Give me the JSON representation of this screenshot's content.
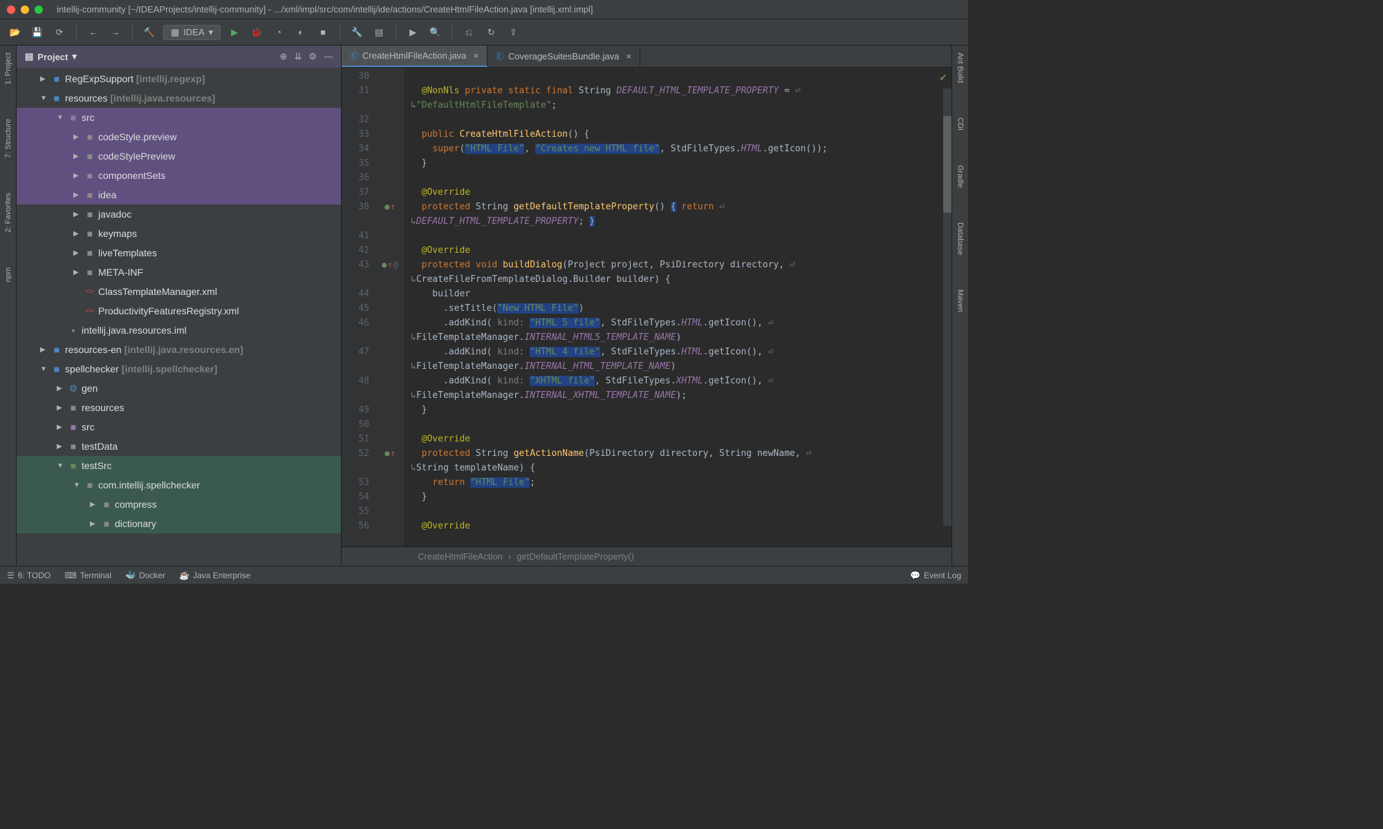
{
  "titlebar": "intellij-community [~/IDEAProjects/intellij-community] - .../xml/impl/src/com/intellij/ide/actions/CreateHtmlFileAction.java [intellij.xml.impl]",
  "runConfig": "IDEA",
  "projectPanel": {
    "title": "Project"
  },
  "tree": [
    {
      "indent": 1,
      "arrow": "▶",
      "iconClass": "folder-blue",
      "icon": "■",
      "label": "RegExpSupport",
      "meta": "[intellij.regexp]",
      "sel": ""
    },
    {
      "indent": 1,
      "arrow": "▼",
      "iconClass": "folder-blue",
      "icon": "■",
      "label": "resources",
      "meta": "[intellij.java.resources]",
      "sel": ""
    },
    {
      "indent": 2,
      "arrow": "▼",
      "iconClass": "folder-purple",
      "icon": "■",
      "label": "src",
      "meta": "",
      "sel": "sel-purple"
    },
    {
      "indent": 3,
      "arrow": "▶",
      "iconClass": "folder-icon",
      "icon": "■",
      "label": "codeStyle.preview",
      "meta": "",
      "sel": "sel-purple"
    },
    {
      "indent": 3,
      "arrow": "▶",
      "iconClass": "folder-icon",
      "icon": "■",
      "label": "codeStylePreview",
      "meta": "",
      "sel": "sel-purple"
    },
    {
      "indent": 3,
      "arrow": "▶",
      "iconClass": "folder-icon",
      "icon": "■",
      "label": "componentSets",
      "meta": "",
      "sel": "sel-purple"
    },
    {
      "indent": 3,
      "arrow": "▶",
      "iconClass": "folder-icon",
      "icon": "■",
      "label": "idea",
      "meta": "",
      "sel": "sel-purple"
    },
    {
      "indent": 3,
      "arrow": "▶",
      "iconClass": "folder-icon",
      "icon": "■",
      "label": "javadoc",
      "meta": "",
      "sel": ""
    },
    {
      "indent": 3,
      "arrow": "▶",
      "iconClass": "folder-icon",
      "icon": "■",
      "label": "keymaps",
      "meta": "",
      "sel": ""
    },
    {
      "indent": 3,
      "arrow": "▶",
      "iconClass": "folder-icon",
      "icon": "■",
      "label": "liveTemplates",
      "meta": "",
      "sel": ""
    },
    {
      "indent": 3,
      "arrow": "▶",
      "iconClass": "folder-icon",
      "icon": "■",
      "label": "META-INF",
      "meta": "",
      "sel": ""
    },
    {
      "indent": 3,
      "arrow": "",
      "iconClass": "xml-icon",
      "icon": "<>",
      "label": "ClassTemplateManager.xml",
      "meta": "",
      "sel": ""
    },
    {
      "indent": 3,
      "arrow": "",
      "iconClass": "xml-icon",
      "icon": "<>",
      "label": "ProductivityFeaturesRegistry.xml",
      "meta": "",
      "sel": ""
    },
    {
      "indent": 2,
      "arrow": "",
      "iconClass": "folder-icon",
      "icon": "▪",
      "label": "intellij.java.resources.iml",
      "meta": "",
      "sel": ""
    },
    {
      "indent": 1,
      "arrow": "▶",
      "iconClass": "folder-blue",
      "icon": "■",
      "label": "resources-en",
      "meta": "[intellij.java.resources.en]",
      "sel": ""
    },
    {
      "indent": 1,
      "arrow": "▼",
      "iconClass": "folder-blue",
      "icon": "■",
      "label": "spellchecker",
      "meta": "[intellij.spellchecker]",
      "sel": ""
    },
    {
      "indent": 2,
      "arrow": "▶",
      "iconClass": "folder-blue",
      "icon": "⚙",
      "label": "gen",
      "meta": "",
      "sel": ""
    },
    {
      "indent": 2,
      "arrow": "▶",
      "iconClass": "folder-icon",
      "icon": "■",
      "label": "resources",
      "meta": "",
      "sel": ""
    },
    {
      "indent": 2,
      "arrow": "▶",
      "iconClass": "folder-purple",
      "icon": "■",
      "label": "src",
      "meta": "",
      "sel": ""
    },
    {
      "indent": 2,
      "arrow": "▶",
      "iconClass": "folder-icon",
      "icon": "■",
      "label": "testData",
      "meta": "",
      "sel": ""
    },
    {
      "indent": 2,
      "arrow": "▼",
      "iconClass": "folder-green",
      "icon": "■",
      "label": "testSrc",
      "meta": "",
      "sel": "sel-teal"
    },
    {
      "indent": 3,
      "arrow": "▼",
      "iconClass": "folder-icon",
      "icon": "■",
      "label": "com.intellij.spellchecker",
      "meta": "",
      "sel": "sel-teal"
    },
    {
      "indent": 4,
      "arrow": "▶",
      "iconClass": "folder-icon",
      "icon": "■",
      "label": "compress",
      "meta": "",
      "sel": "sel-teal"
    },
    {
      "indent": 4,
      "arrow": "▶",
      "iconClass": "folder-icon",
      "icon": "■",
      "label": "dictionary",
      "meta": "",
      "sel": "sel-teal"
    }
  ],
  "tabs": [
    {
      "label": "CreateHtmlFileAction.java",
      "active": true
    },
    {
      "label": "CoverageSuitesBundle.java",
      "active": false
    }
  ],
  "lineNumbers": [
    "30",
    "31",
    "",
    "32",
    "33",
    "34",
    "35",
    "36",
    "37",
    "38",
    "",
    "41",
    "42",
    "43",
    "",
    "44",
    "45",
    "46",
    "",
    "47",
    "",
    "48",
    "",
    "49",
    "50",
    "51",
    "52",
    "",
    "53",
    "54",
    "55",
    "56"
  ],
  "gutterMarks": {
    "9": "●↑",
    "13": "●↑ @",
    "26": "●↑"
  },
  "breadcrumb": {
    "a": "CreateHtmlFileAction",
    "b": "getDefaultTemplateProperty()"
  },
  "statusBar": {
    "todo": "6: TODO",
    "terminal": "Terminal",
    "docker": "Docker",
    "javaee": "Java Enterprise",
    "eventlog": "Event Log"
  },
  "leftGutter": [
    "1: Project",
    "7: Structure",
    "2: Favorites",
    "npm"
  ],
  "rightGutter": [
    "Ant Build",
    "CDI",
    "Gradle",
    "Database",
    "Maven"
  ]
}
